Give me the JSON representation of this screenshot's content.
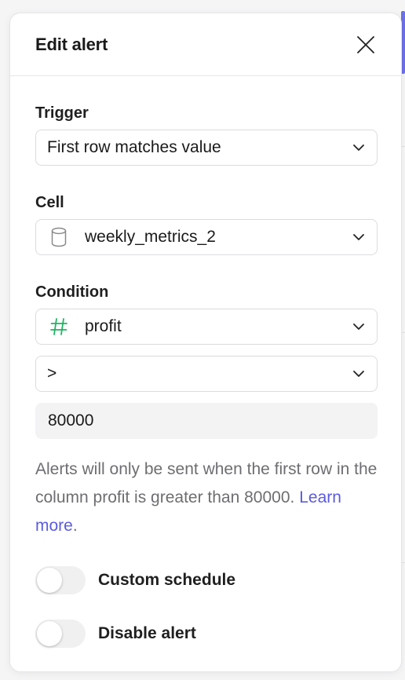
{
  "panel": {
    "title": "Edit alert"
  },
  "trigger": {
    "label": "Trigger",
    "selected": "First row matches value"
  },
  "cell": {
    "label": "Cell",
    "selected": "weekly_metrics_2",
    "icon": "database-icon"
  },
  "condition": {
    "label": "Condition",
    "column": "profit",
    "column_icon": "hash-icon",
    "column_icon_color": "#1fb463",
    "operator": ">",
    "value": "80000"
  },
  "help": {
    "text": "Alerts will only be sent when the first row in the column profit is greater than 80000.",
    "link": "Learn more",
    "trailing": ".",
    "link_color": "#5b5be0"
  },
  "toggles": {
    "custom_schedule": {
      "label": "Custom schedule",
      "on": false
    },
    "disable_alert": {
      "label": "Disable alert",
      "on": false
    }
  },
  "colors": {
    "accent": "#6c6fe8"
  }
}
